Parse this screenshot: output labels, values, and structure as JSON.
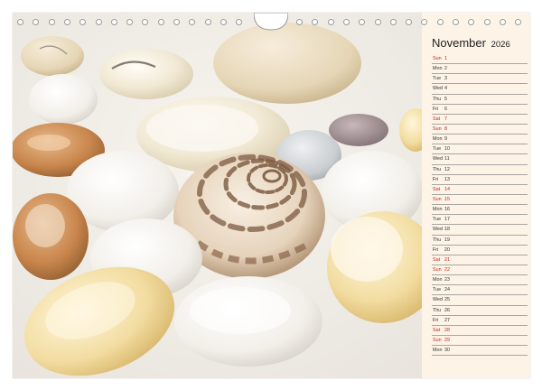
{
  "calendar": {
    "month": "November",
    "year": "2026",
    "days": [
      {
        "dn": "Sun",
        "dd": "1",
        "weekend": true
      },
      {
        "dn": "Mon",
        "dd": "2",
        "weekend": false
      },
      {
        "dn": "Tue",
        "dd": "3",
        "weekend": false
      },
      {
        "dn": "Wed",
        "dd": "4",
        "weekend": false
      },
      {
        "dn": "Thu",
        "dd": "5",
        "weekend": false
      },
      {
        "dn": "Fri",
        "dd": "6",
        "weekend": false
      },
      {
        "dn": "Sat",
        "dd": "7",
        "weekend": true
      },
      {
        "dn": "Sun",
        "dd": "8",
        "weekend": true
      },
      {
        "dn": "Mon",
        "dd": "9",
        "weekend": false
      },
      {
        "dn": "Tue",
        "dd": "10",
        "weekend": false
      },
      {
        "dn": "Wed",
        "dd": "11",
        "weekend": false
      },
      {
        "dn": "Thu",
        "dd": "12",
        "weekend": false
      },
      {
        "dn": "Fri",
        "dd": "13",
        "weekend": false
      },
      {
        "dn": "Sat",
        "dd": "14",
        "weekend": true
      },
      {
        "dn": "Sun",
        "dd": "15",
        "weekend": true
      },
      {
        "dn": "Mon",
        "dd": "16",
        "weekend": false
      },
      {
        "dn": "Tue",
        "dd": "17",
        "weekend": false
      },
      {
        "dn": "Wed",
        "dd": "18",
        "weekend": false
      },
      {
        "dn": "Thu",
        "dd": "19",
        "weekend": false
      },
      {
        "dn": "Fri",
        "dd": "20",
        "weekend": false
      },
      {
        "dn": "Sat",
        "dd": "21",
        "weekend": true
      },
      {
        "dn": "Sun",
        "dd": "22",
        "weekend": true
      },
      {
        "dn": "Mon",
        "dd": "23",
        "weekend": false
      },
      {
        "dn": "Tue",
        "dd": "24",
        "weekend": false
      },
      {
        "dn": "Wed",
        "dd": "25",
        "weekend": false
      },
      {
        "dn": "Thu",
        "dd": "26",
        "weekend": false
      },
      {
        "dn": "Fri",
        "dd": "27",
        "weekend": false
      },
      {
        "dn": "Sat",
        "dd": "28",
        "weekend": true
      },
      {
        "dn": "Sun",
        "dd": "29",
        "weekend": true
      },
      {
        "dn": "Mon",
        "dd": "30",
        "weekend": false
      }
    ]
  },
  "colors": {
    "weekend": "#c8251e",
    "weekday": "#333333",
    "panel": "#fdf3e6"
  },
  "photo": {
    "subject": "shell-and-pebbles-photo"
  }
}
